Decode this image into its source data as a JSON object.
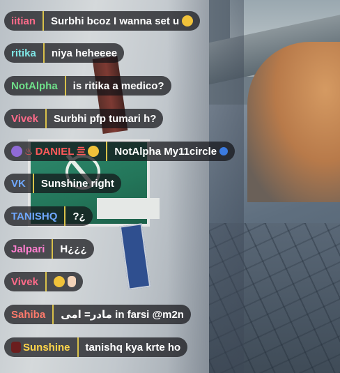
{
  "messages": [
    {
      "user": "iitian",
      "text": "Surbhi bcoz I wanna set u",
      "name_color": "#ff6b8a",
      "badges": [],
      "trail": [
        "grin-emoji"
      ]
    },
    {
      "user": "ritika",
      "text": "niya heheeee",
      "name_color": "#7fe6e6",
      "badges": [],
      "trail": []
    },
    {
      "user": "NotAlpha",
      "text": "is ritika a medico?",
      "name_color": "#6fe08a",
      "badges": [],
      "trail": []
    },
    {
      "user": "Vivek",
      "text": "Surbhi pfp tumari h?",
      "name_color": "#ff6b8a",
      "badges": [],
      "trail": []
    },
    {
      "user": "DANIEL",
      "text": "NotAlpha My11circle",
      "name_color": "#ff5a5a",
      "badges": [
        "purple-face-emoji",
        "thinking-emoji"
      ],
      "name_glyphs_before": "♨",
      "name_glyphs_after": "亖",
      "trail": [
        "blue-heart-emoji"
      ]
    },
    {
      "user": "VK",
      "text": "Sunshine right",
      "name_color": "#6fa8ff",
      "badges": [],
      "trail": []
    },
    {
      "user": "TANISHQ",
      "text": "?¿",
      "name_color": "#6fa8ff",
      "badges": [],
      "trail": []
    },
    {
      "user": "Jalpari",
      "text": "H¿¿¿",
      "name_color": "#ff7fd0",
      "badges": [],
      "trail": []
    },
    {
      "user": "Vivek",
      "text": "",
      "name_color": "#ff6b8a",
      "badges": [],
      "trail": [
        "rofl-emoji",
        "hand-emoji"
      ]
    },
    {
      "user": "Sahiba",
      "text": "مادر= امی in farsi @m2n",
      "name_color": "#ff7a6b",
      "badges": [],
      "trail": []
    },
    {
      "user": "Sunshine",
      "text": "tanishq kya krte ho",
      "name_color": "#ffd54a",
      "badges": [
        "spider-emoji"
      ],
      "trail": []
    }
  ]
}
